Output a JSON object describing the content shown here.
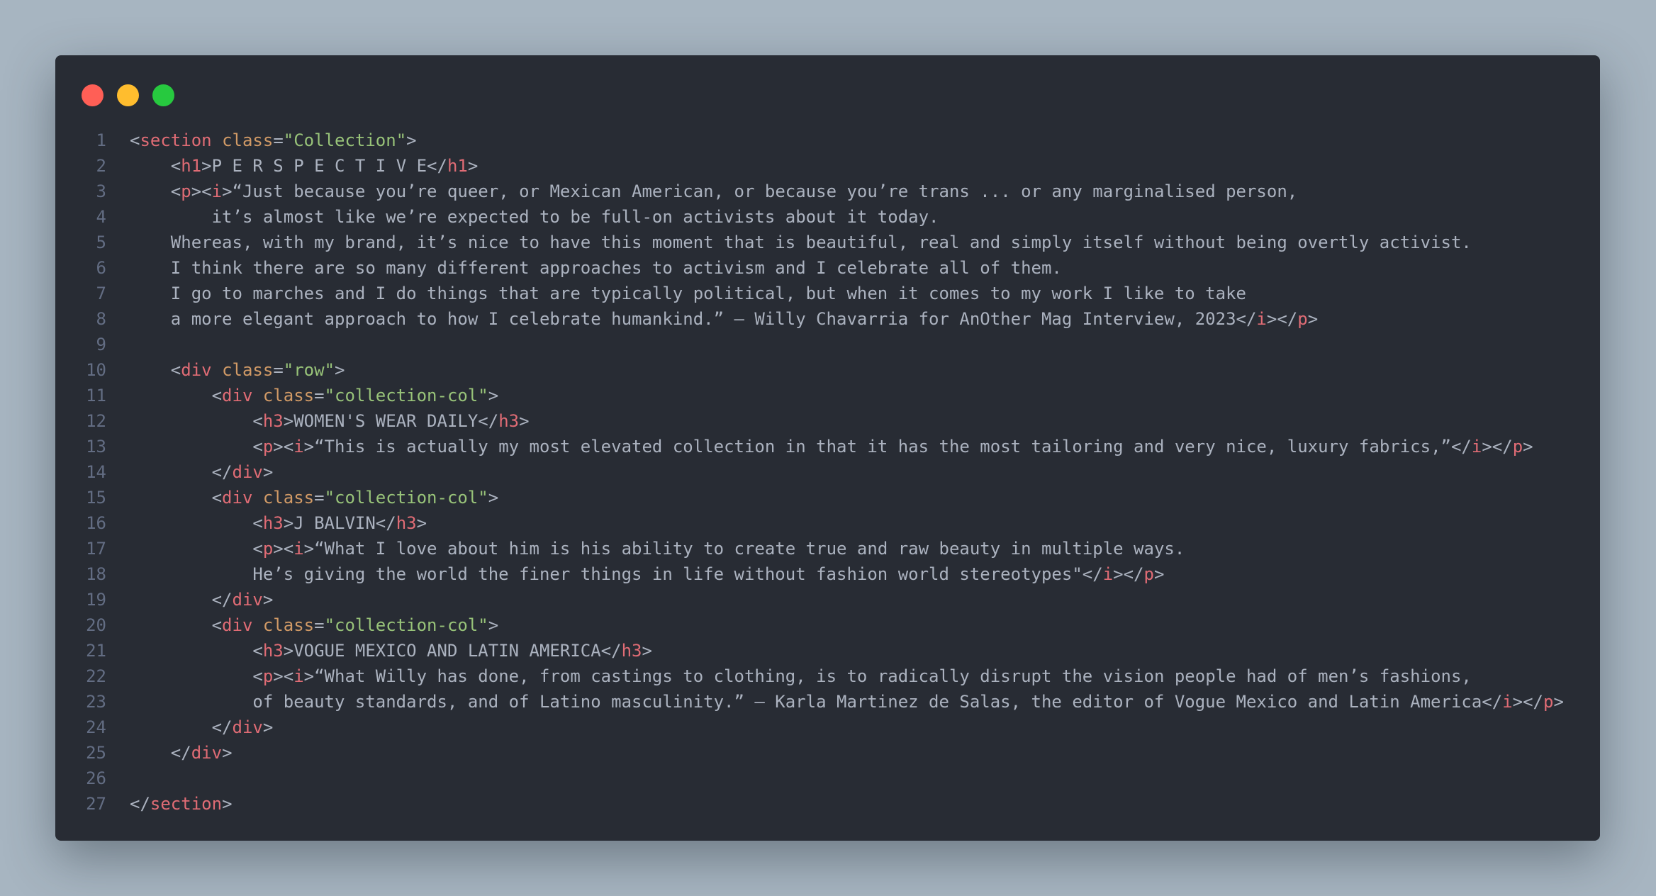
{
  "window": {
    "traffic_lights": [
      {
        "name": "close",
        "color": "#ff5f56"
      },
      {
        "name": "minimize",
        "color": "#ffbd2e"
      },
      {
        "name": "maximize",
        "color": "#27c93f"
      }
    ]
  },
  "theme": {
    "background": "#282c34",
    "tag": "#e06c75",
    "attribute": "#d19a66",
    "string": "#98c379",
    "text": "#abb2bf",
    "line_number": "#636d83"
  },
  "code": {
    "lines": [
      {
        "n": "1",
        "tokens": [
          {
            "c": "p",
            "v": "<"
          },
          {
            "c": "t",
            "v": "section"
          },
          {
            "c": "p",
            "v": " "
          },
          {
            "c": "a",
            "v": "class"
          },
          {
            "c": "p",
            "v": "="
          },
          {
            "c": "s",
            "v": "\"Collection\""
          },
          {
            "c": "p",
            "v": ">"
          }
        ]
      },
      {
        "n": "2",
        "tokens": [
          {
            "c": "p",
            "v": "    <"
          },
          {
            "c": "t",
            "v": "h1"
          },
          {
            "c": "p",
            "v": ">P E R S P E C T I V E</"
          },
          {
            "c": "t",
            "v": "h1"
          },
          {
            "c": "p",
            "v": ">"
          }
        ]
      },
      {
        "n": "3",
        "tokens": [
          {
            "c": "p",
            "v": "    <"
          },
          {
            "c": "t",
            "v": "p"
          },
          {
            "c": "p",
            "v": "><"
          },
          {
            "c": "t",
            "v": "i"
          },
          {
            "c": "p",
            "v": ">“Just because you’re queer, or Mexican American, or because you’re trans ... or any marginalised person,"
          }
        ]
      },
      {
        "n": "4",
        "tokens": [
          {
            "c": "p",
            "v": "        it’s almost like we’re expected to be full-on activists about it today."
          }
        ]
      },
      {
        "n": "5",
        "tokens": [
          {
            "c": "p",
            "v": "    Whereas, with my brand, it’s nice to have this moment that is beautiful, real and simply itself without being overtly activist."
          }
        ]
      },
      {
        "n": "6",
        "tokens": [
          {
            "c": "p",
            "v": "    I think there are so many different approaches to activism and I celebrate all of them."
          }
        ]
      },
      {
        "n": "7",
        "tokens": [
          {
            "c": "p",
            "v": "    I go to marches and I do things that are typically political, but when it comes to my work I like to take"
          }
        ]
      },
      {
        "n": "8",
        "tokens": [
          {
            "c": "p",
            "v": "    a more elegant approach to how I celebrate humankind.” — Willy Chavarria for AnOther Mag Interview, 2023</"
          },
          {
            "c": "t",
            "v": "i"
          },
          {
            "c": "p",
            "v": "></"
          },
          {
            "c": "t",
            "v": "p"
          },
          {
            "c": "p",
            "v": ">"
          }
        ]
      },
      {
        "n": "9",
        "tokens": []
      },
      {
        "n": "10",
        "tokens": [
          {
            "c": "p",
            "v": "    <"
          },
          {
            "c": "t",
            "v": "div"
          },
          {
            "c": "p",
            "v": " "
          },
          {
            "c": "a",
            "v": "class"
          },
          {
            "c": "p",
            "v": "="
          },
          {
            "c": "s",
            "v": "\"row\""
          },
          {
            "c": "p",
            "v": ">"
          }
        ]
      },
      {
        "n": "11",
        "tokens": [
          {
            "c": "p",
            "v": "        <"
          },
          {
            "c": "t",
            "v": "div"
          },
          {
            "c": "p",
            "v": " "
          },
          {
            "c": "a",
            "v": "class"
          },
          {
            "c": "p",
            "v": "="
          },
          {
            "c": "s",
            "v": "\"collection-col\""
          },
          {
            "c": "p",
            "v": ">"
          }
        ]
      },
      {
        "n": "12",
        "tokens": [
          {
            "c": "p",
            "v": "            <"
          },
          {
            "c": "t",
            "v": "h3"
          },
          {
            "c": "p",
            "v": ">WOMEN'S WEAR DAILY</"
          },
          {
            "c": "t",
            "v": "h3"
          },
          {
            "c": "p",
            "v": ">"
          }
        ]
      },
      {
        "n": "13",
        "tokens": [
          {
            "c": "p",
            "v": "            <"
          },
          {
            "c": "t",
            "v": "p"
          },
          {
            "c": "p",
            "v": "><"
          },
          {
            "c": "t",
            "v": "i"
          },
          {
            "c": "p",
            "v": ">“This is actually my most elevated collection in that it has the most tailoring and very nice, luxury fabrics,”</"
          },
          {
            "c": "t",
            "v": "i"
          },
          {
            "c": "p",
            "v": "></"
          },
          {
            "c": "t",
            "v": "p"
          },
          {
            "c": "p",
            "v": ">"
          }
        ]
      },
      {
        "n": "14",
        "tokens": [
          {
            "c": "p",
            "v": "        </"
          },
          {
            "c": "t",
            "v": "div"
          },
          {
            "c": "p",
            "v": ">"
          }
        ]
      },
      {
        "n": "15",
        "tokens": [
          {
            "c": "p",
            "v": "        <"
          },
          {
            "c": "t",
            "v": "div"
          },
          {
            "c": "p",
            "v": " "
          },
          {
            "c": "a",
            "v": "class"
          },
          {
            "c": "p",
            "v": "="
          },
          {
            "c": "s",
            "v": "\"collection-col\""
          },
          {
            "c": "p",
            "v": ">"
          }
        ]
      },
      {
        "n": "16",
        "tokens": [
          {
            "c": "p",
            "v": "            <"
          },
          {
            "c": "t",
            "v": "h3"
          },
          {
            "c": "p",
            "v": ">J BALVIN</"
          },
          {
            "c": "t",
            "v": "h3"
          },
          {
            "c": "p",
            "v": ">"
          }
        ]
      },
      {
        "n": "17",
        "tokens": [
          {
            "c": "p",
            "v": "            <"
          },
          {
            "c": "t",
            "v": "p"
          },
          {
            "c": "p",
            "v": "><"
          },
          {
            "c": "t",
            "v": "i"
          },
          {
            "c": "p",
            "v": ">“What I love about him is his ability to create true and raw beauty in multiple ways."
          }
        ]
      },
      {
        "n": "18",
        "tokens": [
          {
            "c": "p",
            "v": "            He’s giving the world the finer things in life without fashion world stereotypes\"</"
          },
          {
            "c": "t",
            "v": "i"
          },
          {
            "c": "p",
            "v": "></"
          },
          {
            "c": "t",
            "v": "p"
          },
          {
            "c": "p",
            "v": ">"
          }
        ]
      },
      {
        "n": "19",
        "tokens": [
          {
            "c": "p",
            "v": "        </"
          },
          {
            "c": "t",
            "v": "div"
          },
          {
            "c": "p",
            "v": ">"
          }
        ]
      },
      {
        "n": "20",
        "tokens": [
          {
            "c": "p",
            "v": "        <"
          },
          {
            "c": "t",
            "v": "div"
          },
          {
            "c": "p",
            "v": " "
          },
          {
            "c": "a",
            "v": "class"
          },
          {
            "c": "p",
            "v": "="
          },
          {
            "c": "s",
            "v": "\"collection-col\""
          },
          {
            "c": "p",
            "v": ">"
          }
        ]
      },
      {
        "n": "21",
        "tokens": [
          {
            "c": "p",
            "v": "            <"
          },
          {
            "c": "t",
            "v": "h3"
          },
          {
            "c": "p",
            "v": ">VOGUE MEXICO AND LATIN AMERICA</"
          },
          {
            "c": "t",
            "v": "h3"
          },
          {
            "c": "p",
            "v": ">"
          }
        ]
      },
      {
        "n": "22",
        "tokens": [
          {
            "c": "p",
            "v": "            <"
          },
          {
            "c": "t",
            "v": "p"
          },
          {
            "c": "p",
            "v": "><"
          },
          {
            "c": "t",
            "v": "i"
          },
          {
            "c": "p",
            "v": ">“What Willy has done, from castings to clothing, is to radically disrupt the vision people had of men’s fashions,"
          }
        ]
      },
      {
        "n": "23",
        "tokens": [
          {
            "c": "p",
            "v": "            of beauty standards, and of Latino masculinity.” — Karla Martinez de Salas, the editor of Vogue Mexico and Latin America</"
          },
          {
            "c": "t",
            "v": "i"
          },
          {
            "c": "p",
            "v": "></"
          },
          {
            "c": "t",
            "v": "p"
          },
          {
            "c": "p",
            "v": ">"
          }
        ]
      },
      {
        "n": "24",
        "tokens": [
          {
            "c": "p",
            "v": "        </"
          },
          {
            "c": "t",
            "v": "div"
          },
          {
            "c": "p",
            "v": ">"
          }
        ]
      },
      {
        "n": "25",
        "tokens": [
          {
            "c": "p",
            "v": "    </"
          },
          {
            "c": "t",
            "v": "div"
          },
          {
            "c": "p",
            "v": ">"
          }
        ]
      },
      {
        "n": "26",
        "tokens": []
      },
      {
        "n": "27",
        "tokens": [
          {
            "c": "p",
            "v": "</"
          },
          {
            "c": "t",
            "v": "section"
          },
          {
            "c": "p",
            "v": ">"
          }
        ]
      }
    ]
  }
}
